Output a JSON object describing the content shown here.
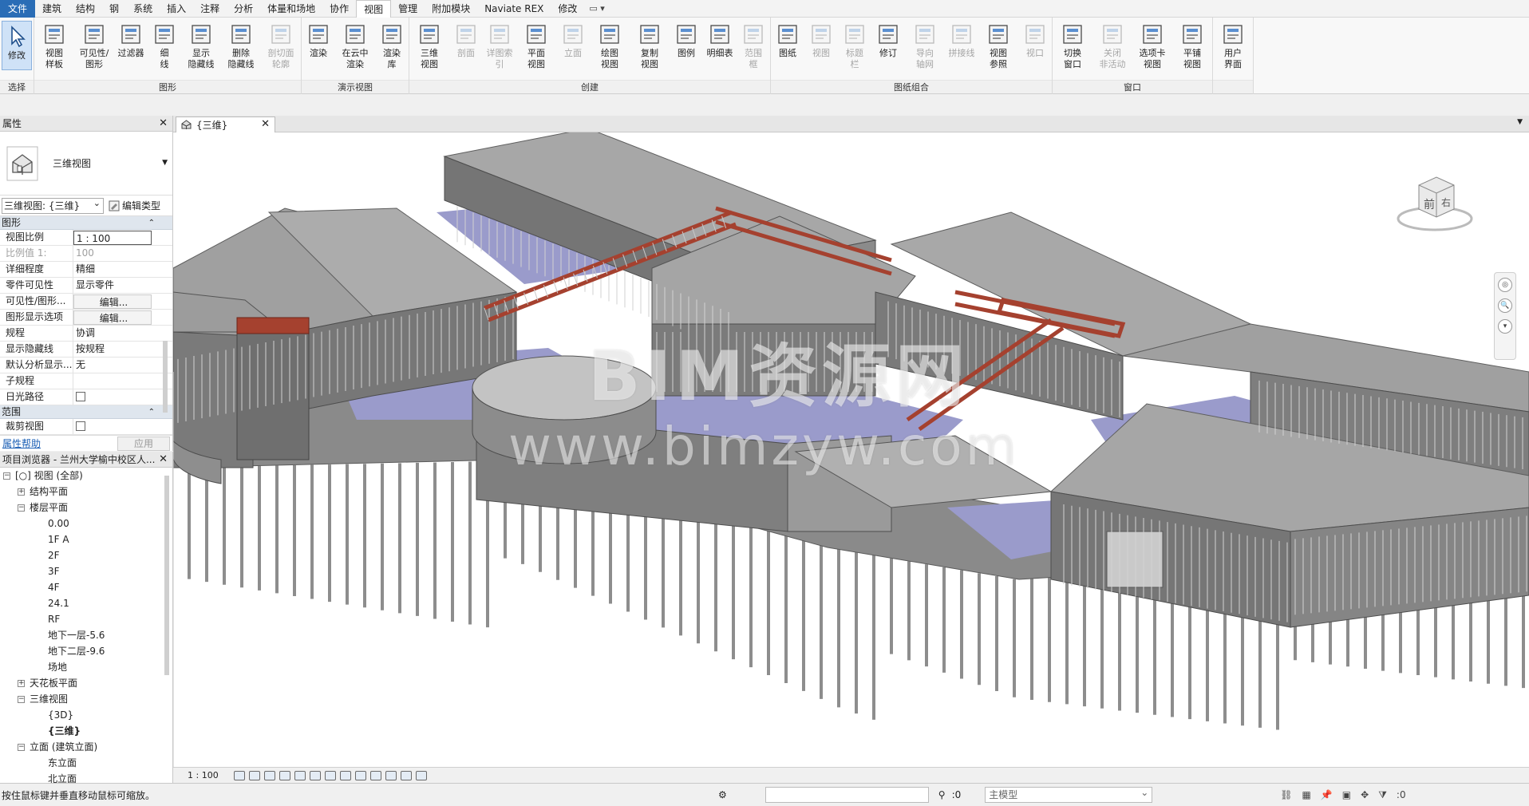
{
  "menu": {
    "tabs": [
      "文件",
      "建筑",
      "结构",
      "钢",
      "系统",
      "插入",
      "注释",
      "分析",
      "体量和场地",
      "协作",
      "视图",
      "管理",
      "附加模块",
      "Naviate REX",
      "修改"
    ],
    "active": "视图"
  },
  "ribbon": {
    "panels": [
      {
        "label": "选择",
        "tools": [
          {
            "label": "修改",
            "icon": "cursor-icon",
            "enabled": true
          }
        ]
      },
      {
        "label": "图形",
        "tools": [
          {
            "label": "视图\n样板",
            "icon": "view-template-icon",
            "enabled": true
          },
          {
            "label": "可见性/\n图形",
            "icon": "visibility-graphics-icon",
            "enabled": true
          },
          {
            "label": "过滤器",
            "icon": "filter-icon",
            "enabled": true
          },
          {
            "label": "细\n线",
            "icon": "thin-lines-icon",
            "enabled": true
          },
          {
            "label": "显示\n隐藏线",
            "icon": "show-hidden-lines-icon",
            "enabled": true
          },
          {
            "label": "删除\n隐藏线",
            "icon": "remove-hidden-lines-icon",
            "enabled": true
          },
          {
            "label": "剖切面\n轮廓",
            "icon": "cut-profile-icon",
            "enabled": false
          }
        ]
      },
      {
        "label": "演示视图",
        "tools": [
          {
            "label": "渲染",
            "icon": "render-icon",
            "enabled": true
          },
          {
            "label": "在云中\n渲染",
            "icon": "cloud-render-icon",
            "enabled": true
          },
          {
            "label": "渲染\n库",
            "icon": "render-gallery-icon",
            "enabled": true
          }
        ]
      },
      {
        "label": "创建",
        "tools": [
          {
            "label": "三维\n视图",
            "icon": "3d-view-icon",
            "enabled": true
          },
          {
            "label": "剖面",
            "icon": "section-icon",
            "enabled": false
          },
          {
            "label": "详图索引",
            "icon": "callout-icon",
            "enabled": false
          },
          {
            "label": "平面\n视图",
            "icon": "plan-view-icon",
            "enabled": true
          },
          {
            "label": "立面",
            "icon": "elevation-icon",
            "enabled": false
          },
          {
            "label": "绘图\n视图",
            "icon": "drafting-view-icon",
            "enabled": true
          },
          {
            "label": "复制\n视图",
            "icon": "duplicate-view-icon",
            "enabled": true
          },
          {
            "label": "图例",
            "icon": "legend-icon",
            "enabled": true
          },
          {
            "label": "明细表",
            "icon": "schedule-icon",
            "enabled": true
          },
          {
            "label": "范围\n框",
            "icon": "scope-box-icon",
            "enabled": false
          }
        ]
      },
      {
        "label": "图纸组合",
        "tools": [
          {
            "label": "图纸",
            "icon": "sheet-icon",
            "enabled": true
          },
          {
            "label": "视图",
            "icon": "place-view-icon",
            "enabled": false
          },
          {
            "label": "标题\n栏",
            "icon": "title-block-icon",
            "enabled": false
          },
          {
            "label": "修订",
            "icon": "revisions-icon",
            "enabled": true
          },
          {
            "label": "导向\n轴网",
            "icon": "guide-grid-icon",
            "enabled": false
          },
          {
            "label": "拼接线",
            "icon": "matchline-icon",
            "enabled": false
          },
          {
            "label": "视图\n参照",
            "icon": "view-reference-icon",
            "enabled": true
          },
          {
            "label": "视口",
            "icon": "viewports-icon",
            "enabled": false
          }
        ]
      },
      {
        "label": "窗口",
        "tools": [
          {
            "label": "切换\n窗口",
            "icon": "switch-windows-icon",
            "enabled": true
          },
          {
            "label": "关闭\n非活动",
            "icon": "close-inactive-icon",
            "enabled": false
          },
          {
            "label": "选项卡\n视图",
            "icon": "tab-views-icon",
            "enabled": true
          },
          {
            "label": "平铺\n视图",
            "icon": "tile-views-icon",
            "enabled": true
          }
        ]
      },
      {
        "label": "",
        "tools": [
          {
            "label": "用户\n界面",
            "icon": "user-interface-icon",
            "enabled": true
          }
        ]
      }
    ]
  },
  "properties": {
    "title": "属性",
    "type_name": "三维视图",
    "type_selector": "三维视图: {三维}",
    "edit_type": "编辑类型",
    "groups": [
      {
        "name": "图形",
        "rows": [
          {
            "k": "视图比例",
            "v": "1 : 100",
            "style": "box"
          },
          {
            "k": "比例值 1:",
            "v": "100",
            "style": "dim"
          },
          {
            "k": "详细程度",
            "v": "精细"
          },
          {
            "k": "零件可见性",
            "v": "显示零件"
          },
          {
            "k": "可见性/图形...",
            "v": "编辑...",
            "style": "btn"
          },
          {
            "k": "图形显示选项",
            "v": "编辑...",
            "style": "btn"
          },
          {
            "k": "规程",
            "v": "协调"
          },
          {
            "k": "显示隐藏线",
            "v": "按规程"
          },
          {
            "k": "默认分析显示...",
            "v": "无"
          },
          {
            "k": "子规程",
            "v": ""
          },
          {
            "k": "日光路径",
            "v": "",
            "style": "chk"
          }
        ]
      },
      {
        "name": "范围",
        "rows": [
          {
            "k": "裁剪视图",
            "v": "",
            "style": "chk"
          }
        ]
      }
    ],
    "help_link": "属性帮助",
    "apply": "应用"
  },
  "browser": {
    "title": "项目浏览器 - 兰州大学榆中校区人...",
    "nodes": [
      {
        "label": "视图 (全部)",
        "level": 0,
        "toggle": "-",
        "icon": true
      },
      {
        "label": "结构平面",
        "level": 1,
        "toggle": "+"
      },
      {
        "label": "楼层平面",
        "level": 1,
        "toggle": "-"
      },
      {
        "label": "0.00",
        "level": 2
      },
      {
        "label": "1F  A",
        "level": 2
      },
      {
        "label": "2F",
        "level": 2
      },
      {
        "label": "3F",
        "level": 2
      },
      {
        "label": "4F",
        "level": 2
      },
      {
        "label": "24.1",
        "level": 2
      },
      {
        "label": "RF",
        "level": 2
      },
      {
        "label": "地下一层-5.6",
        "level": 2
      },
      {
        "label": "地下二层-9.6",
        "level": 2
      },
      {
        "label": "场地",
        "level": 2
      },
      {
        "label": "天花板平面",
        "level": 1,
        "toggle": "+"
      },
      {
        "label": "三维视图",
        "level": 1,
        "toggle": "-"
      },
      {
        "label": "{3D}",
        "level": 2
      },
      {
        "label": "{三维}",
        "level": 2,
        "bold": true
      },
      {
        "label": "立面 (建筑立面)",
        "level": 1,
        "toggle": "-"
      },
      {
        "label": "东立面",
        "level": 2
      },
      {
        "label": "北立面",
        "level": 2
      }
    ]
  },
  "view": {
    "tab_label": "{三维}",
    "watermark_1": "BIM资源网",
    "watermark_2": "www.bimzyw.com",
    "cube_front": "前",
    "cube_right": "右",
    "scale": "1 : 100"
  },
  "status": {
    "message": "按住鼠标键并垂直移动鼠标可缩放。",
    "zero": ":0",
    "model": "主模型",
    "filter_count": ":0"
  },
  "colors": {
    "accent": "#2a6db6",
    "roof": "#9a9a9a",
    "wall": "#7c7c7c",
    "floor_blue": "#9a9bcb",
    "truss_red": "#a5412f"
  }
}
